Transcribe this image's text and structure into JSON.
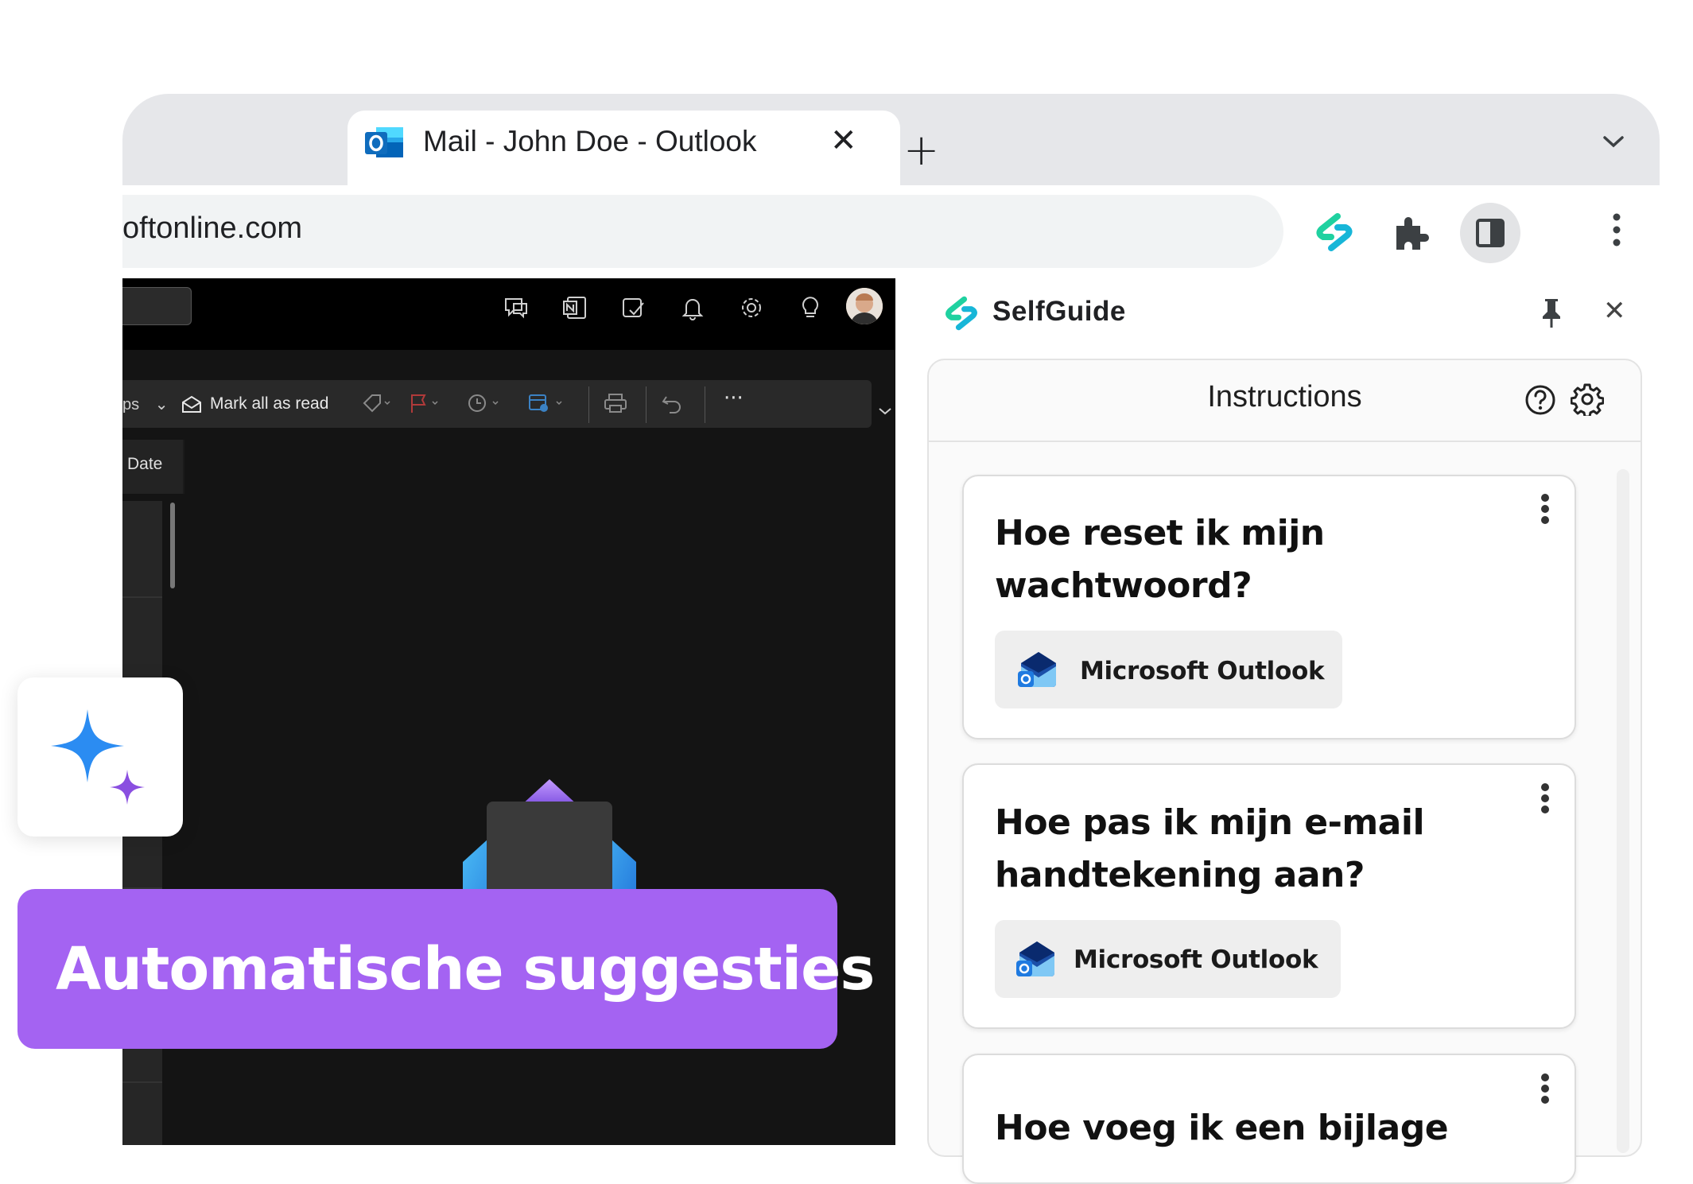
{
  "browser": {
    "tab_title": "Mail - John Doe - Outlook",
    "tab_close": "✕",
    "new_tab": "+",
    "url": "oftonline.com"
  },
  "outlook": {
    "ribbon": {
      "filter_label": "ps",
      "mark_all_read": "Mark all as read",
      "more": "···"
    },
    "list_header": "Date"
  },
  "panel": {
    "title": "SelfGuide",
    "close": "✕",
    "section_title": "Instructions",
    "cards": [
      {
        "title": "Hoe reset ik mijn wachtwoord?",
        "tag": "Microsoft Outlook"
      },
      {
        "title": "Hoe pas ik mijn e-mail handtekening aan?",
        "tag": "Microsoft Outlook"
      },
      {
        "title": "Hoe voeg ik een bijlage",
        "tag": ""
      }
    ]
  },
  "banner": {
    "text": "Automatische suggesties"
  },
  "colors": {
    "accent_purple": "#a463f2",
    "selfguide_green": "#1fd1a0",
    "outlook_blue": "#0f6cbd",
    "spark_blue": "#2b8cf2",
    "spark_purple": "#8a4fe0"
  }
}
